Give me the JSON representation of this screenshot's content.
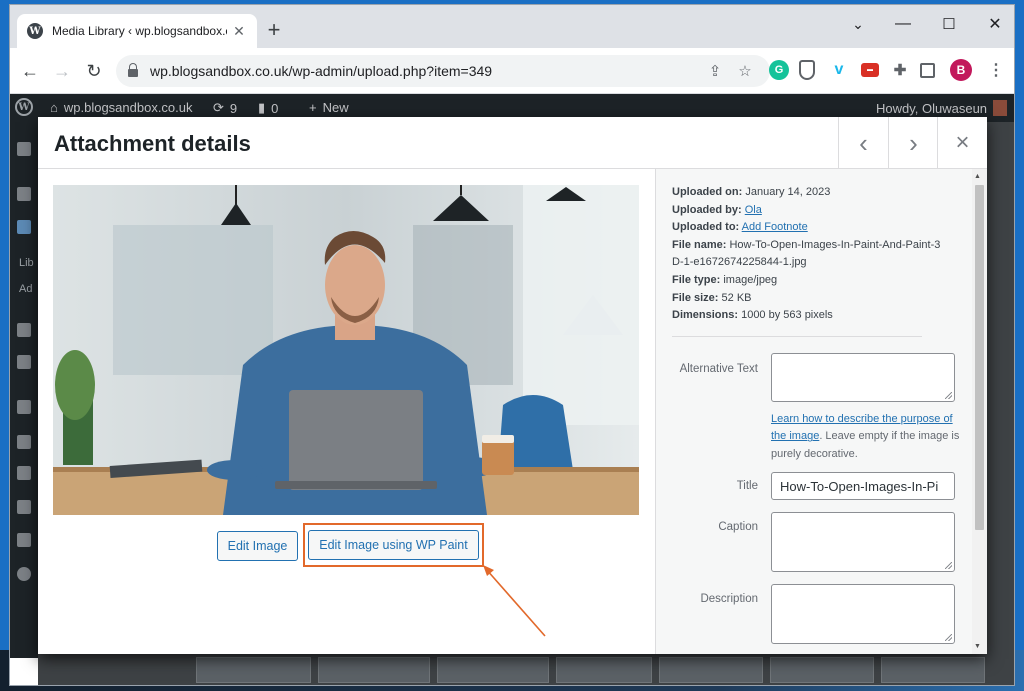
{
  "browser": {
    "tab_title": "Media Library ‹ wp.blogsandbox.co.uk",
    "tab_favicon": "W",
    "new_tab": "+",
    "url": "wp.blogsandbox.co.uk/wp-admin/upload.php?item=349",
    "profile_initial": "B",
    "controls": {
      "minimize": "—",
      "maximize": "☐",
      "close": "✕",
      "tab_list": "⌄"
    }
  },
  "wp_admin_bar": {
    "site_name": "wp.blogsandbox.co.uk",
    "updates_count": "9",
    "comments_count": "0",
    "new_label": "New",
    "greeting": "Howdy, Oluwaseun"
  },
  "sidebar": {
    "text_fragments": [
      "Lib",
      "Ad"
    ]
  },
  "modal": {
    "title": "Attachment details",
    "prev_icon": "‹",
    "next_icon": "›",
    "close_icon": "×",
    "buttons": {
      "edit_image": "Edit Image",
      "edit_wp_paint": "Edit Image using WP Paint"
    },
    "meta": {
      "uploaded_on_label": "Uploaded on:",
      "uploaded_on": "January 14, 2023",
      "uploaded_by_label": "Uploaded by:",
      "uploaded_by": "Ola",
      "uploaded_to_label": "Uploaded to:",
      "uploaded_to": "Add Footnote",
      "file_name_label": "File name:",
      "file_name": "How-To-Open-Images-In-Paint-And-Paint-3D-1-e1672674225844-1.jpg",
      "file_type_label": "File type:",
      "file_type": "image/jpeg",
      "file_size_label": "File size:",
      "file_size": "52 KB",
      "dimensions_label": "Dimensions:",
      "dimensions": "1000 by 563 pixels"
    },
    "fields": {
      "alt_text_label": "Alternative Text",
      "alt_text_value": "",
      "alt_help_link": "Learn how to describe the purpose of the image",
      "alt_help_text": ". Leave empty if the image is purely decorative.",
      "title_label": "Title",
      "title_value": "How-To-Open-Images-In-Pi",
      "caption_label": "Caption",
      "caption_value": "",
      "description_label": "Description",
      "description_value": ""
    }
  },
  "colors": {
    "wp_blue": "#2271b1",
    "highlight_orange": "#e2692b",
    "admin_bar": "#1d2327"
  }
}
